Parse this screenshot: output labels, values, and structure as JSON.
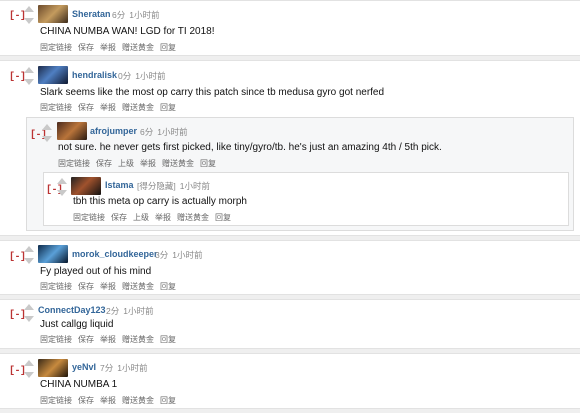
{
  "collapse_label": "[-]",
  "actions": [
    "固定链接",
    "保存",
    "上级",
    "举报",
    "赠送黄金",
    "回复"
  ],
  "comments": [
    {
      "author": "Sheratan",
      "score": "6分",
      "time": "1小时前",
      "text": "CHINA NUMBA WAN! LGD for TI 2018!",
      "actions": [
        "固定链接",
        "保存",
        "举报",
        "赠送黄金",
        "回复"
      ]
    },
    {
      "author": "hendralisk",
      "score": "0分",
      "time": "1小时前",
      "text": "Slark seems like the most op carry this patch since tb medusa gyro got nerfed",
      "actions": [
        "固定链接",
        "保存",
        "举报",
        "赠送黄金",
        "回复"
      ]
    },
    {
      "author": "afrojumper",
      "score": "6分",
      "time": "1小时前",
      "text": "not sure. he never gets first picked, like tiny/gyro/tb. he's just an amazing 4th / 5th pick.",
      "actions": [
        "固定链接",
        "保存",
        "上级",
        "举报",
        "赠送黄金",
        "回复"
      ]
    },
    {
      "author": "Istama",
      "score": "[得分隐藏]",
      "time": "1小时前",
      "text": "tbh this meta op carry is actually morph",
      "actions": [
        "固定链接",
        "保存",
        "上级",
        "举报",
        "赠送黄金",
        "回复"
      ]
    },
    {
      "author": "morok_cloudkeeper",
      "score": "3分",
      "time": "1小时前",
      "text": "Fy played out of his mind",
      "actions": [
        "固定链接",
        "保存",
        "举报",
        "赠送黄金",
        "回复"
      ]
    },
    {
      "author": "ConnectDay123",
      "score": "2分",
      "time": "1小时前",
      "text": "Just callgg liquid",
      "actions": [
        "固定链接",
        "保存",
        "举报",
        "赠送黄金",
        "回复"
      ]
    },
    {
      "author": "yeNvI",
      "score": "7分",
      "time": "1小时前",
      "text": "CHINA NUMBA 1",
      "actions": [
        "固定链接",
        "保存",
        "举报",
        "赠送黄金",
        "回复"
      ]
    }
  ]
}
